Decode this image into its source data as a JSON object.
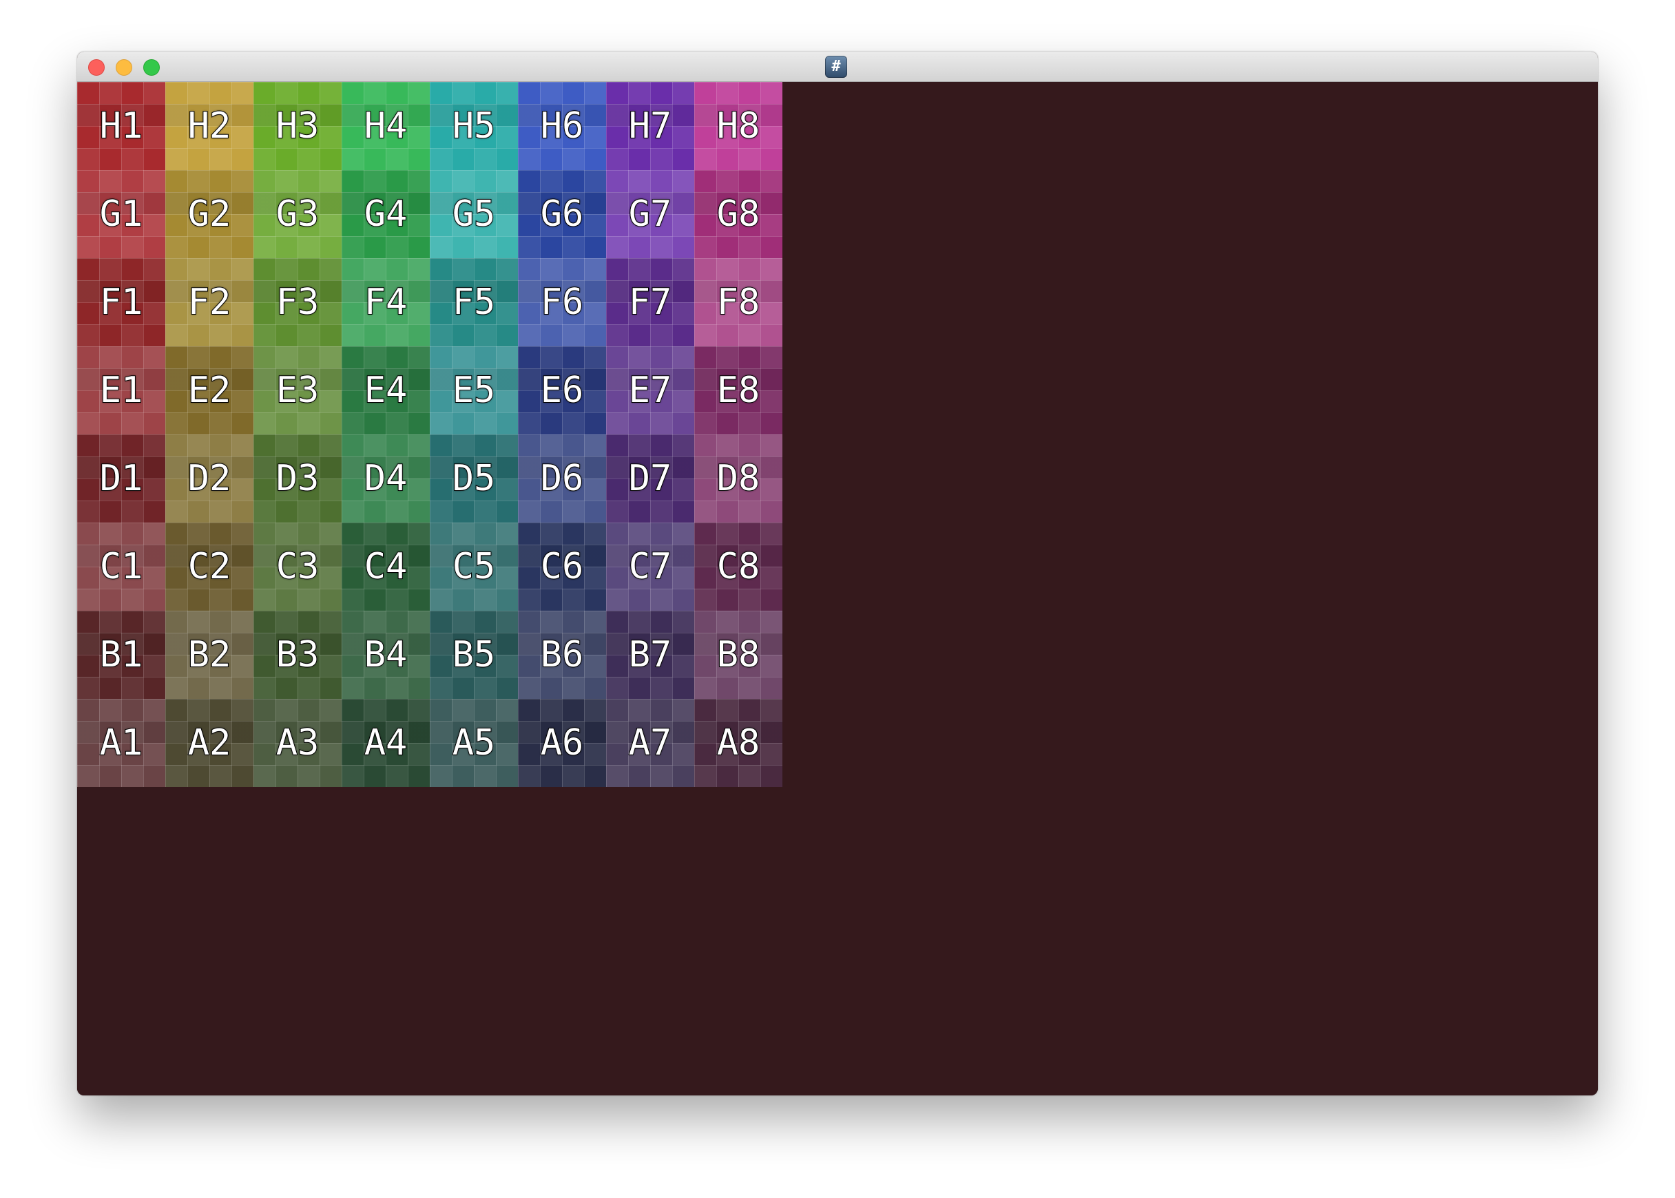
{
  "window": {
    "title_icon": "#",
    "traffic_lights": {
      "close": "#fc605c",
      "minimize": "#fdbc40",
      "zoom": "#34c84a"
    },
    "background": "#35191c"
  },
  "grid": {
    "rows": [
      {
        "rank": "H",
        "cells": [
          {
            "label": "H1",
            "color": "#a82a2e"
          },
          {
            "label": "H2",
            "color": "#c4a340"
          },
          {
            "label": "H3",
            "color": "#6aac2a"
          },
          {
            "label": "H4",
            "color": "#38b95a"
          },
          {
            "label": "H5",
            "color": "#29aba8"
          },
          {
            "label": "H6",
            "color": "#3e5cc4"
          },
          {
            "label": "H7",
            "color": "#6a2eaa"
          },
          {
            "label": "H8",
            "color": "#c0409a"
          }
        ]
      },
      {
        "rank": "G",
        "cells": [
          {
            "label": "G1",
            "color": "#b03e44"
          },
          {
            "label": "G2",
            "color": "#a58a32"
          },
          {
            "label": "G3",
            "color": "#76ae40"
          },
          {
            "label": "G4",
            "color": "#2a9a48"
          },
          {
            "label": "G5",
            "color": "#3fb5b0"
          },
          {
            "label": "G6",
            "color": "#2b46a0"
          },
          {
            "label": "G7",
            "color": "#7c48b6"
          },
          {
            "label": "G8",
            "color": "#a02e78"
          }
        ]
      },
      {
        "rank": "F",
        "cells": [
          {
            "label": "F1",
            "color": "#8e2628"
          },
          {
            "label": "F2",
            "color": "#a99445"
          },
          {
            "label": "F3",
            "color": "#5e8e30"
          },
          {
            "label": "F4",
            "color": "#45a862"
          },
          {
            "label": "F5",
            "color": "#268a86"
          },
          {
            "label": "F6",
            "color": "#4c62b0"
          },
          {
            "label": "F7",
            "color": "#5a2c8a"
          },
          {
            "label": "F8",
            "color": "#b05290"
          }
        ]
      },
      {
        "rank": "E",
        "cells": [
          {
            "label": "E1",
            "color": "#9e4448"
          },
          {
            "label": "E2",
            "color": "#806a2a"
          },
          {
            "label": "E3",
            "color": "#6e9448"
          },
          {
            "label": "E4",
            "color": "#2a7a42"
          },
          {
            "label": "E5",
            "color": "#40979a"
          },
          {
            "label": "E6",
            "color": "#2a3a7e"
          },
          {
            "label": "E7",
            "color": "#6a4696"
          },
          {
            "label": "E8",
            "color": "#7a2a62"
          }
        ]
      },
      {
        "rank": "D",
        "cells": [
          {
            "label": "D1",
            "color": "#702428"
          },
          {
            "label": "D2",
            "color": "#8e7e46"
          },
          {
            "label": "D3",
            "color": "#4e7030"
          },
          {
            "label": "D4",
            "color": "#3e8a56"
          },
          {
            "label": "D5",
            "color": "#276e70"
          },
          {
            "label": "D6",
            "color": "#49578e"
          },
          {
            "label": "D7",
            "color": "#4a2a6e"
          },
          {
            "label": "D8",
            "color": "#8e4a7a"
          }
        ]
      },
      {
        "rank": "C",
        "cells": [
          {
            "label": "C1",
            "color": "#8a4a4e"
          },
          {
            "label": "C2",
            "color": "#6a5a2e"
          },
          {
            "label": "C3",
            "color": "#5e7a44"
          },
          {
            "label": "C4",
            "color": "#2a5e38"
          },
          {
            "label": "C5",
            "color": "#3e7a7a"
          },
          {
            "label": "C6",
            "color": "#2a3660"
          },
          {
            "label": "C7",
            "color": "#5a4a7e"
          },
          {
            "label": "C8",
            "color": "#5e2a4e"
          }
        ]
      },
      {
        "rank": "B",
        "cells": [
          {
            "label": "B1",
            "color": "#582628"
          },
          {
            "label": "B2",
            "color": "#736a4c"
          },
          {
            "label": "B3",
            "color": "#405a30"
          },
          {
            "label": "B4",
            "color": "#3e6a4a"
          },
          {
            "label": "B5",
            "color": "#2a5a5a"
          },
          {
            "label": "B6",
            "color": "#444c6e"
          },
          {
            "label": "B7",
            "color": "#3e2e58"
          },
          {
            "label": "B8",
            "color": "#70486a"
          }
        ]
      },
      {
        "rank": "A",
        "cells": [
          {
            "label": "A1",
            "color": "#6a4446"
          },
          {
            "label": "A2",
            "color": "#4e4a32"
          },
          {
            "label": "A3",
            "color": "#4e5e42"
          },
          {
            "label": "A4",
            "color": "#2a4a34"
          },
          {
            "label": "A5",
            "color": "#3e5e5e"
          },
          {
            "label": "A6",
            "color": "#2a2e48"
          },
          {
            "label": "A7",
            "color": "#4a405e"
          },
          {
            "label": "A8",
            "color": "#4a2a40"
          }
        ]
      }
    ]
  }
}
